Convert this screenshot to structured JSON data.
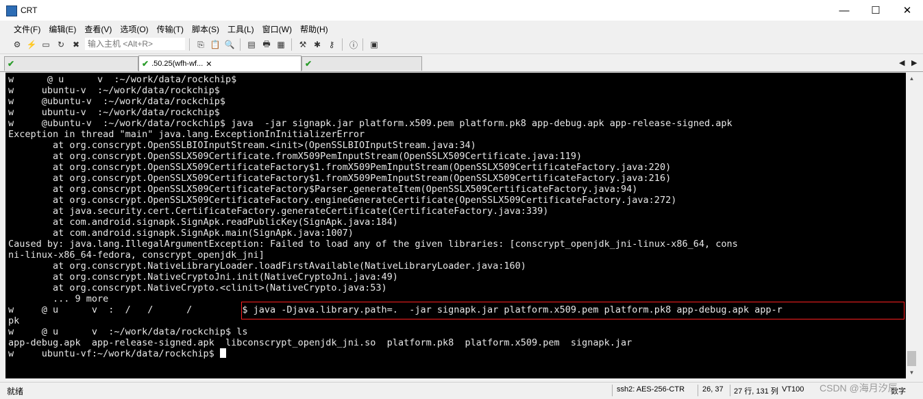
{
  "window": {
    "title": "CRT",
    "minimize_glyph": "—",
    "maximize_glyph": "☐",
    "close_glyph": "✕"
  },
  "menu": [
    "文件(F)",
    "编辑(E)",
    "查看(V)",
    "选项(O)",
    "传输(T)",
    "脚本(S)",
    "工具(L)",
    "窗口(W)",
    "帮助(H)"
  ],
  "toolbar": {
    "host_placeholder": "输入主机 <Alt+R>"
  },
  "tabs": [
    {
      "label": "",
      "active": false
    },
    {
      "label": ".50.25(wfh-wf...",
      "active": true
    },
    {
      "label": "",
      "active": false
    }
  ],
  "terminal": {
    "lines": [
      "w      @ u      v  :~/work/data/rockchip$",
      "w     ubuntu-v  :~/work/data/rockchip$",
      "w     @ubuntu-v  :~/work/data/rockchip$",
      "w     ubuntu-v  :~/work/data/rockchip$",
      "w     @ubuntu-v  :~/work/data/rockchip$ java  -jar signapk.jar platform.x509.pem platform.pk8 app-debug.apk app-release-signed.apk",
      "Exception in thread \"main\" java.lang.ExceptionInInitializerError",
      "        at org.conscrypt.OpenSSLBIOInputStream.<init>(OpenSSLBIOInputStream.java:34)",
      "        at org.conscrypt.OpenSSLX509Certificate.fromX509PemInputStream(OpenSSLX509Certificate.java:119)",
      "        at org.conscrypt.OpenSSLX509CertificateFactory$1.fromX509PemInputStream(OpenSSLX509CertificateFactory.java:220)",
      "        at org.conscrypt.OpenSSLX509CertificateFactory$1.fromX509PemInputStream(OpenSSLX509CertificateFactory.java:216)",
      "        at org.conscrypt.OpenSSLX509CertificateFactory$Parser.generateItem(OpenSSLX509CertificateFactory.java:94)",
      "        at org.conscrypt.OpenSSLX509CertificateFactory.engineGenerateCertificate(OpenSSLX509CertificateFactory.java:272)",
      "        at java.security.cert.CertificateFactory.generateCertificate(CertificateFactory.java:339)",
      "        at com.android.signapk.SignApk.readPublicKey(SignApk.java:184)",
      "        at com.android.signapk.SignApk.main(SignApk.java:1007)",
      "Caused by: java.lang.IllegalArgumentException: Failed to load any of the given libraries: [conscrypt_openjdk_jni-linux-x86_64, cons",
      "ni-linux-x86_64-fedora, conscrypt_openjdk_jni]",
      "        at org.conscrypt.NativeLibraryLoader.loadFirstAvailable(NativeLibraryLoader.java:160)",
      "        at org.conscrypt.NativeCryptoJni.init(NativeCryptoJni.java:49)",
      "        at org.conscrypt.NativeCrypto.<clinit>(NativeCrypto.java:53)",
      "        ... 9 more",
      "w     @ u      v  :  /   /      /         $ java -Djava.library.path=.  -jar signapk.jar platform.x509.pem platform.pk8 app-debug.apk app-r",
      "pk",
      "w     @ u      v  :~/work/data/rockchip$ ls",
      "app-debug.apk  app-release-signed.apk  libconscrypt_openjdk_jni.so  platform.pk8  platform.x509.pem  signapk.jar",
      "w     ubuntu-vf:~/work/data/rockchip$ "
    ]
  },
  "status": {
    "ready": "就绪",
    "cipher": "ssh2: AES-256-CTR",
    "cursor_pos": "26,  37",
    "size": "27 行, 131 列",
    "term_type": "VT100",
    "caps": "数字",
    "watermark": "CSDN @海月汐辰"
  }
}
